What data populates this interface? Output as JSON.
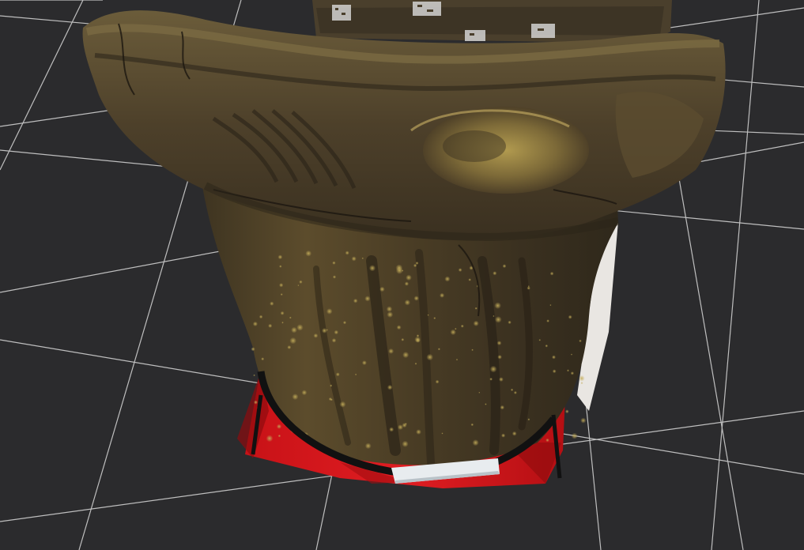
{
  "viewer": {
    "background_color": "#2b2b2d",
    "grid_color": "#d9d9d9",
    "grid_visible": true
  },
  "model": {
    "object_icon": "fossil-bone-scan-mesh",
    "colors": {
      "bone_dark": "#3a3222",
      "bone_mid": "#5e4f30",
      "bone_light": "#8a7640",
      "ochre_highlight": "#b59a4a",
      "mount_red": "#d8161b",
      "mount_red_dark": "#8e0b0e",
      "strap_black": "#121212",
      "label_white": "#e7ebee"
    },
    "background_specimen_icon": "specimen-tray-with-labels"
  }
}
